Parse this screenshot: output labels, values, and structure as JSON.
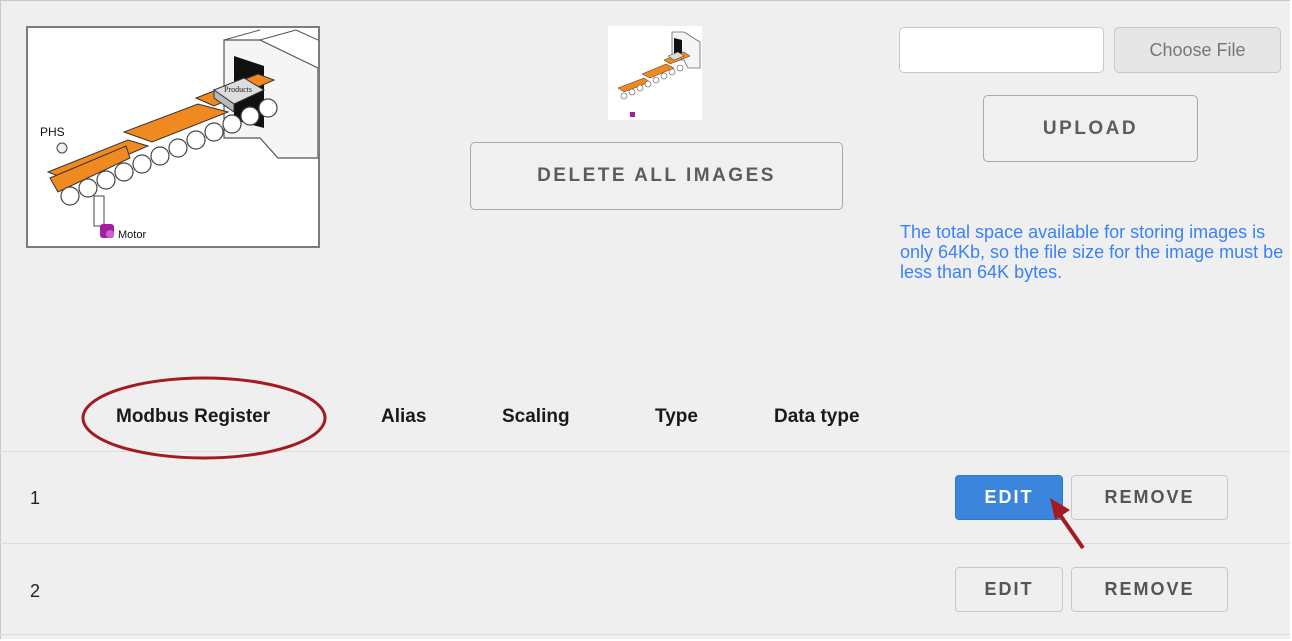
{
  "images": {
    "main_alt": "Conveyor illustration",
    "labels": {
      "phs": "PHS",
      "products": "Products",
      "motor": "Motor"
    },
    "thumbnail_alt": "Conveyor thumbnail"
  },
  "actions": {
    "delete_all_label": "DELETE ALL IMAGES",
    "choose_file_label": "Choose File",
    "upload_label": "UPLOAD"
  },
  "note": "The total space available for storing images is only 64Kb, so the file size for the image must be less than 64K bytes.",
  "table": {
    "columns": [
      "Modbus Register",
      "Alias",
      "Scaling",
      "Type",
      "Data type"
    ],
    "rows": [
      {
        "register": "1",
        "alias": "",
        "scaling": "",
        "type": "",
        "data_type": "",
        "edit_label": "EDIT",
        "remove_label": "REMOVE"
      },
      {
        "register": "2",
        "alias": "",
        "scaling": "",
        "type": "",
        "data_type": "",
        "edit_label": "EDIT",
        "remove_label": "REMOVE"
      }
    ]
  },
  "colors": {
    "note_text": "#3a82f7",
    "edit_active": "#3b86dc",
    "annotation": "#a31a22",
    "conveyor_belt": "#f0891f"
  },
  "icons": [
    "motor-icon",
    "sensor-icon"
  ]
}
